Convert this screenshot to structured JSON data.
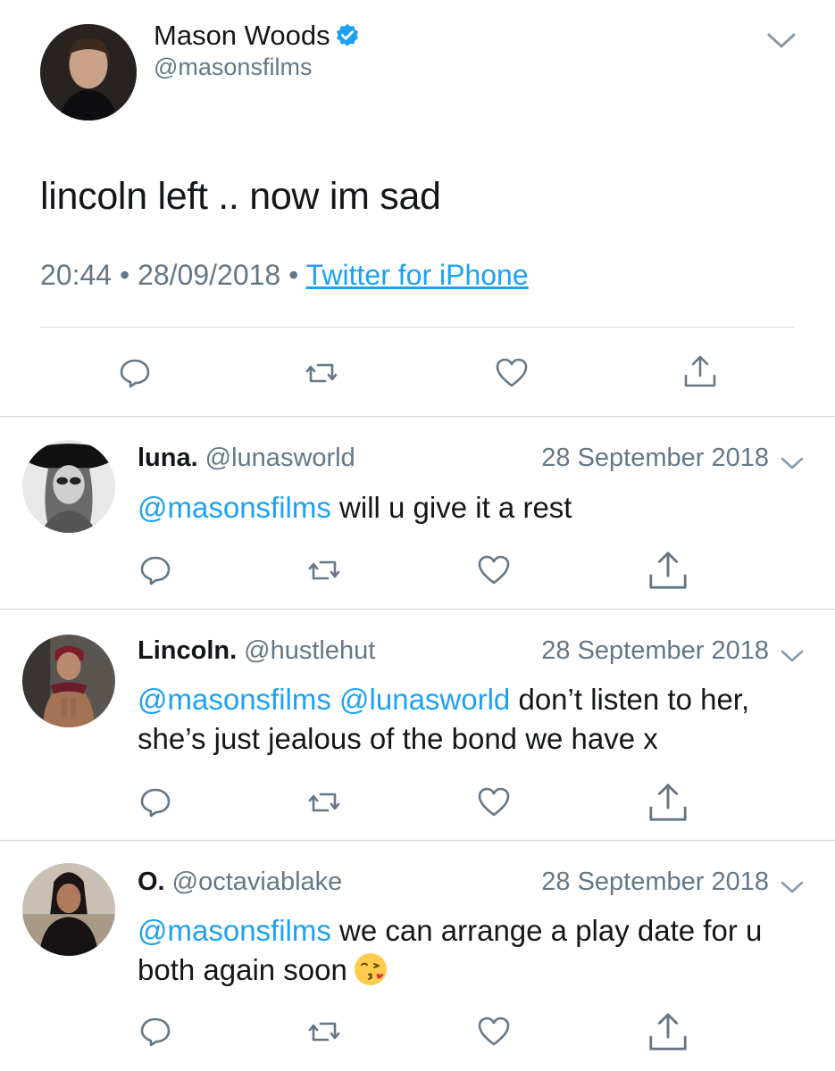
{
  "main_tweet": {
    "name": "Mason Woods",
    "handle": "@masonsfilms",
    "text": "lincoln left .. now im sad",
    "time": "20:44",
    "date": "28/09/2018",
    "separator": "•",
    "source": "Twitter for iPhone",
    "verified": true
  },
  "replies": [
    {
      "name": "luna.",
      "handle": "@lunasworld",
      "date": "28 September 2018",
      "mentions": "@masonsfilms",
      "text": " will u give it a rest"
    },
    {
      "name": "Lincoln.",
      "handle": "@hustlehut",
      "date": "28 September 2018",
      "mentions": "@masonsfilms @lunasworld",
      "text": " don’t listen to her, she’s just jealous of the bond we have x"
    },
    {
      "name": "O.",
      "handle": "@octaviablake",
      "date": "28 September 2018",
      "mentions": "@masonsfilms",
      "text": " we can arrange a play date for u both again soon",
      "emoji": "kissing-face-with-heart"
    }
  ],
  "icons": {
    "reply": "reply-icon",
    "retweet": "retweet-icon",
    "like": "heart-icon",
    "share": "share-icon",
    "more": "chevron-down-icon",
    "verified": "verified-badge-icon"
  },
  "colors": {
    "accent": "#1da1f2",
    "text": "#14171a",
    "secondary": "#657786",
    "divider": "#ccd6dd"
  }
}
